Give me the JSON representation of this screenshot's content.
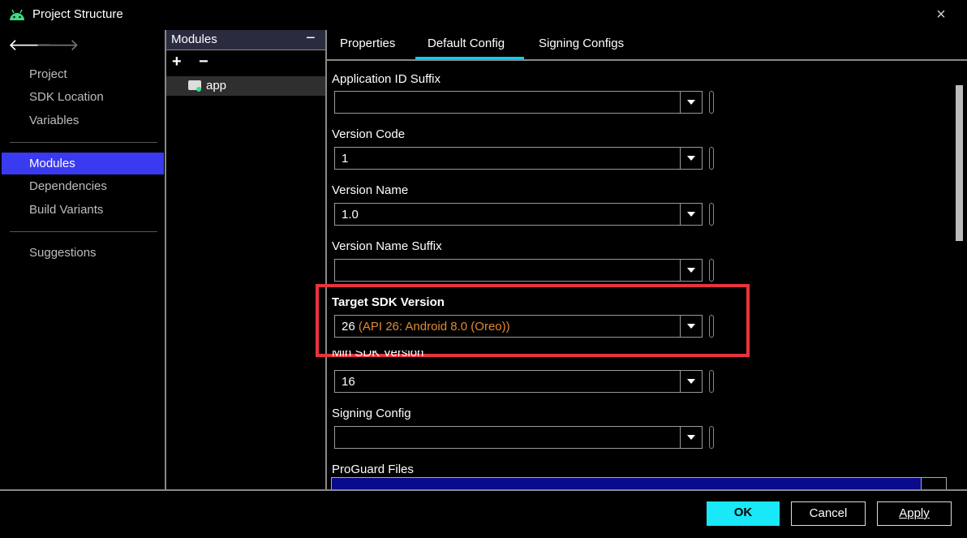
{
  "window": {
    "title": "Project Structure",
    "icon": "android-icon",
    "close": "×"
  },
  "nav": {
    "back": "🡐",
    "forward": "🡒"
  },
  "sidebar": {
    "items": [
      {
        "label": "Project"
      },
      {
        "label": "SDK Location"
      },
      {
        "label": "Variables"
      },
      {
        "label": "Modules",
        "selected": true
      },
      {
        "label": "Dependencies"
      },
      {
        "label": "Build Variants"
      },
      {
        "label": "Suggestions"
      }
    ]
  },
  "modules": {
    "title": "Modules",
    "collapse": "−",
    "add": "+",
    "remove": "−",
    "items": [
      {
        "label": "app"
      }
    ]
  },
  "tabs": [
    {
      "label": "Properties"
    },
    {
      "label": "Default Config",
      "active": true
    },
    {
      "label": "Signing Configs"
    }
  ],
  "form": {
    "fields": [
      {
        "label": "Application ID Suffix",
        "value": ""
      },
      {
        "label": "Version Code",
        "value": "1"
      },
      {
        "label": "Version Name",
        "value": "1.0"
      },
      {
        "label": "Version Name Suffix",
        "value": ""
      },
      {
        "label": "Target SDK Version",
        "value": "26",
        "hint": "(API 26: Android 8.0 (Oreo))"
      },
      {
        "label": "Min SDK Version",
        "value": "16"
      },
      {
        "label": "Signing Config",
        "value": ""
      }
    ],
    "proguard_label": "ProGuard Files"
  },
  "footer": {
    "ok": "OK",
    "cancel": "Cancel",
    "apply": "Apply"
  },
  "colors": {
    "accent": "#18c8f0",
    "selection": "#3a3af0",
    "highlight": "#e8343c",
    "hint": "#e08a30"
  }
}
